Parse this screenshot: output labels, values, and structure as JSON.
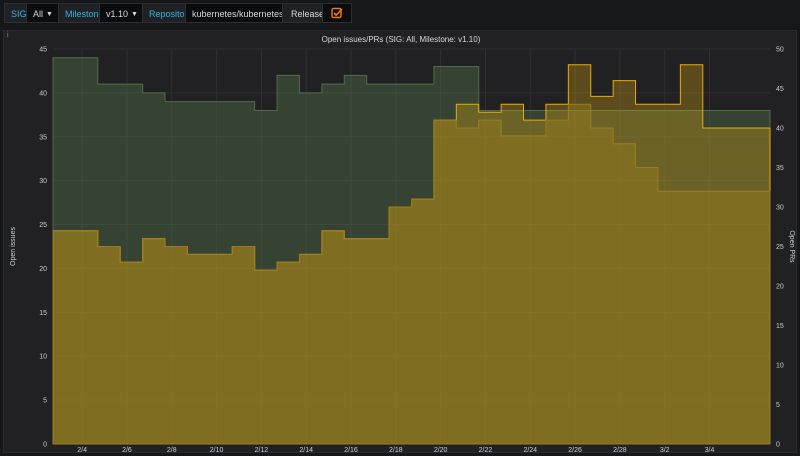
{
  "toolbar": {
    "sig_label": "SIG",
    "sig_value": "All",
    "milestone_label": "Milestone",
    "milestone_value": "v1.10",
    "repository_label": "Repository",
    "repository_value": "kubernetes/kubernetes",
    "releases_label": "Releases",
    "releases_checked": true,
    "accent_color": "#33b5e5",
    "check_color": "#eb7b18",
    "dropdown_icon": "caret-down-icon"
  },
  "panel": {
    "corner_mark": "i"
  },
  "chart_data": {
    "type": "area",
    "title": "Open issues/PRs (SIG: All, Milestone: v1.10)",
    "ylabel_left": "Open issues",
    "ylabel_right": "Open PRs",
    "ylim_left": [
      0,
      45
    ],
    "ylim_right": [
      0,
      50
    ],
    "yticks_left": [
      0,
      5,
      10,
      15,
      20,
      25,
      30,
      35,
      40,
      45
    ],
    "yticks_right": [
      0,
      5,
      10,
      15,
      20,
      25,
      30,
      35,
      40,
      45,
      50
    ],
    "xticks": [
      "2/4",
      "2/6",
      "2/8",
      "2/10",
      "2/12",
      "2/14",
      "2/16",
      "2/18",
      "2/20",
      "2/22",
      "2/24",
      "2/26",
      "2/28",
      "3/2",
      "3/4"
    ],
    "grid": true,
    "x_start": "2/3",
    "step": "half-day",
    "series": [
      {
        "axis": "left",
        "color": "#4f6d47",
        "values": [
          44,
          44,
          41,
          41,
          40,
          39,
          39,
          39,
          39,
          38,
          42,
          40,
          41,
          42,
          41,
          41,
          41,
          43,
          43,
          38,
          38,
          38,
          38,
          38,
          38,
          38,
          38,
          38,
          38,
          38,
          38,
          38
        ]
      },
      {
        "axis": "right",
        "color": "#e5ac0e",
        "values": [
          27,
          27,
          25,
          23,
          26,
          25,
          24,
          24,
          25,
          22,
          23,
          24,
          27,
          26,
          26,
          30,
          31,
          41,
          43,
          42,
          43,
          41,
          43,
          48,
          44,
          46,
          43,
          43,
          48,
          40,
          40,
          40
        ]
      },
      {
        "axis": "right",
        "color": "#9a7e1d",
        "values": [
          27,
          27,
          25,
          23,
          26,
          25,
          24,
          24,
          25,
          22,
          23,
          24,
          27,
          26,
          26,
          30,
          31,
          41,
          40,
          41,
          39,
          39,
          41,
          43,
          40,
          38,
          35,
          32,
          32,
          32,
          32,
          32
        ]
      }
    ]
  }
}
